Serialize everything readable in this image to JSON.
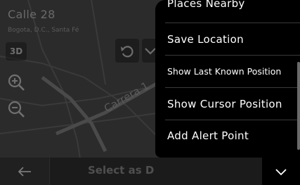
{
  "header": {
    "title": "Calle 28",
    "subtitle": "Bogota, D.C., Santa Fé"
  },
  "map": {
    "street_label": "Carrera 1",
    "view_mode_label": "3D"
  },
  "bottom_bar": {
    "select_label": "Select as D"
  },
  "menu": {
    "items": [
      {
        "label": "Places Nearby"
      },
      {
        "label": "Save Location"
      },
      {
        "label": "Show Last Known Position"
      },
      {
        "label": "Show Cursor Position"
      },
      {
        "label": "Add Alert Point"
      }
    ]
  },
  "icons": {
    "back": "arrow-left-icon",
    "more": "chevron-down-icon",
    "undo": "undo-icon",
    "zoom_in": "zoom-in-icon",
    "zoom_out": "zoom-out-icon"
  },
  "colors": {
    "menu_background": "#000000",
    "map_background": "#2b2b2b",
    "text_primary": "#ffffff"
  }
}
